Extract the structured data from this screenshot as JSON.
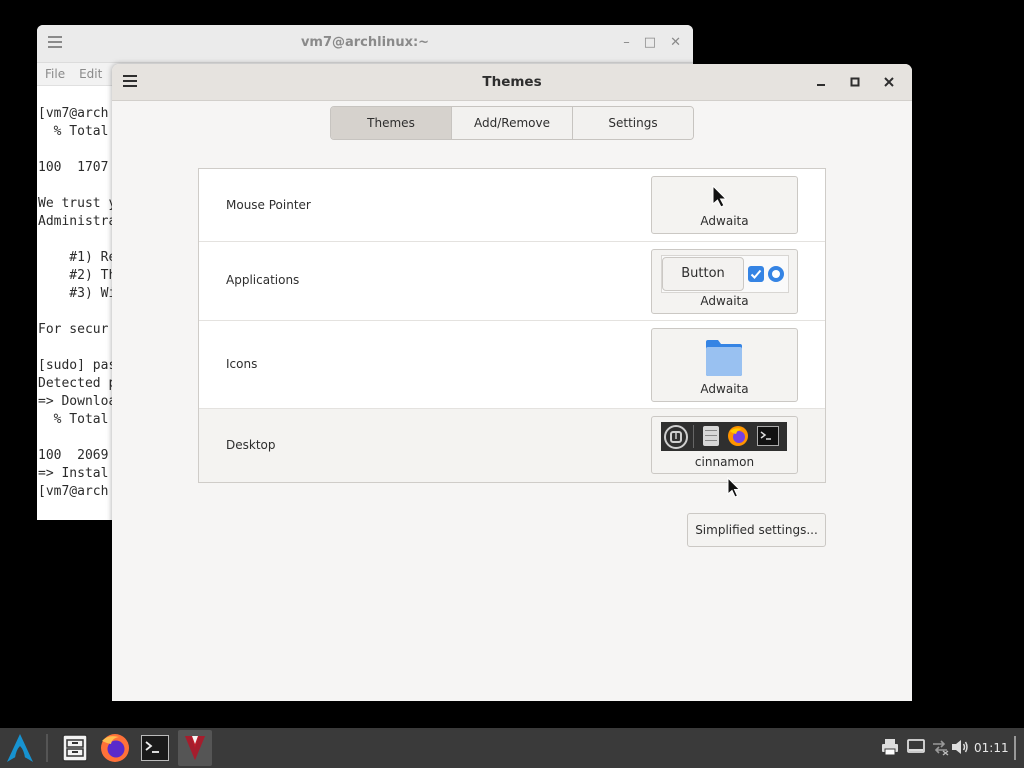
{
  "terminal": {
    "title": "vm7@archlinux:~",
    "menu": [
      "File",
      "Edit"
    ],
    "lines": [
      "",
      "[vm7@arch",
      "  % Total",
      "",
      "100  1707",
      "",
      "We trust y",
      "Administra",
      "",
      "    #1) Re",
      "    #2) Th",
      "    #3) Wi",
      "",
      "For secur",
      "",
      "[sudo] pas",
      "Detected p",
      "=> Downloa",
      "  % Total",
      "",
      "100  2069",
      "=> Instal",
      "[vm7@arch"
    ]
  },
  "themes": {
    "title": "Themes",
    "tabs": [
      {
        "label": "Themes",
        "active": true
      },
      {
        "label": "Add/Remove",
        "active": false
      },
      {
        "label": "Settings",
        "active": false
      }
    ],
    "rows": [
      {
        "label": "Mouse Pointer",
        "value": "Adwaita"
      },
      {
        "label": "Applications",
        "value": "Adwaita",
        "preview_button": "Button"
      },
      {
        "label": "Icons",
        "value": "Adwaita"
      },
      {
        "label": "Desktop",
        "value": "cinnamon"
      }
    ],
    "simplified_button": "Simplified settings..."
  },
  "taskbar": {
    "clock": "01:11"
  },
  "colors": {
    "accent_blue": "#3584e4",
    "folder_blue": "#62a0ea",
    "taskbar_bg": "#3a3a3a",
    "arch_blue": "#1793d1"
  }
}
